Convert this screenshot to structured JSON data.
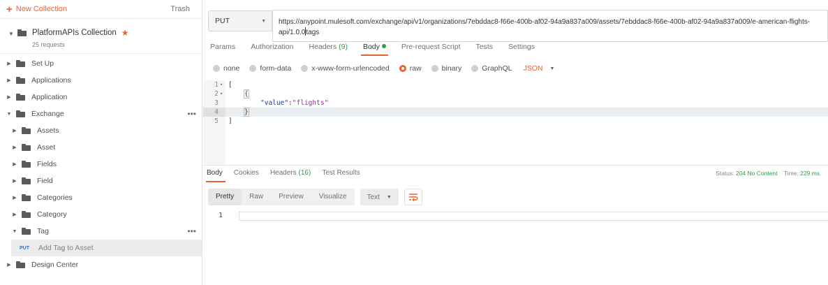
{
  "sidebar": {
    "new_collection": "New Collection",
    "trash": "Trash",
    "collection": {
      "name": "PlatformAPIs Collection",
      "count": "25 requests"
    },
    "folders_top": [
      {
        "label": "Set Up"
      },
      {
        "label": "Applications"
      },
      {
        "label": "Application"
      },
      {
        "label": "Exchange"
      }
    ],
    "exchange_children": [
      {
        "label": "Assets"
      },
      {
        "label": "Asset"
      },
      {
        "label": "Fields"
      },
      {
        "label": "Field"
      },
      {
        "label": "Categories"
      },
      {
        "label": "Category"
      },
      {
        "label": "Tag"
      }
    ],
    "request": {
      "method": "PUT",
      "name": "Add Tag to Asset"
    },
    "folders_bottom": [
      {
        "label": "Design Center"
      }
    ],
    "more_glyph": "•••"
  },
  "request": {
    "method": "PUT",
    "url_before_cursor": "https://anypoint.mulesoft.com/exchange/api/v1/organizations/7ebddac8-f66e-400b-af02-94a9a837a009/assets/7ebddac8-f66e-400b-af02-94a9a837a009/e-american-flights-api/1.0.0",
    "url_after_cursor": "tags",
    "tabs": [
      {
        "label": "Params"
      },
      {
        "label": "Authorization"
      },
      {
        "label": "Headers",
        "count": "(9)"
      },
      {
        "label": "Body"
      },
      {
        "label": "Pre-request Script"
      },
      {
        "label": "Tests"
      },
      {
        "label": "Settings"
      }
    ],
    "body_options": [
      "none",
      "form-data",
      "x-www-form-urlencoded",
      "raw",
      "binary",
      "GraphQL"
    ],
    "body_format": "JSON",
    "code_lines": [
      {
        "n": "1",
        "fold": "▾",
        "text": "["
      },
      {
        "n": "2",
        "fold": "▾",
        "text": "{"
      },
      {
        "n": "3",
        "fold": "",
        "key": "\"value\"",
        "sep": ":",
        "val": "\"flights\""
      },
      {
        "n": "4",
        "fold": "",
        "text": "}"
      },
      {
        "n": "5",
        "fold": "",
        "text": "]"
      }
    ]
  },
  "response": {
    "tabs": [
      {
        "label": "Body"
      },
      {
        "label": "Cookies"
      },
      {
        "label": "Headers",
        "count": "(16)"
      },
      {
        "label": "Test Results"
      }
    ],
    "status_label": "Status:",
    "status_value": "204 No Content",
    "time_label": "Time:",
    "time_value": "229 ms",
    "view_modes": [
      "Pretty",
      "Raw",
      "Preview",
      "Visualize"
    ],
    "format": "Text",
    "line_number": "1"
  },
  "colors": {
    "accent": "#e8632e",
    "success": "#2e9b4f",
    "method_put": "#3a73b5"
  },
  "icons": {
    "chevron_down": "▾",
    "chevron_right": "▸",
    "star": "★"
  }
}
